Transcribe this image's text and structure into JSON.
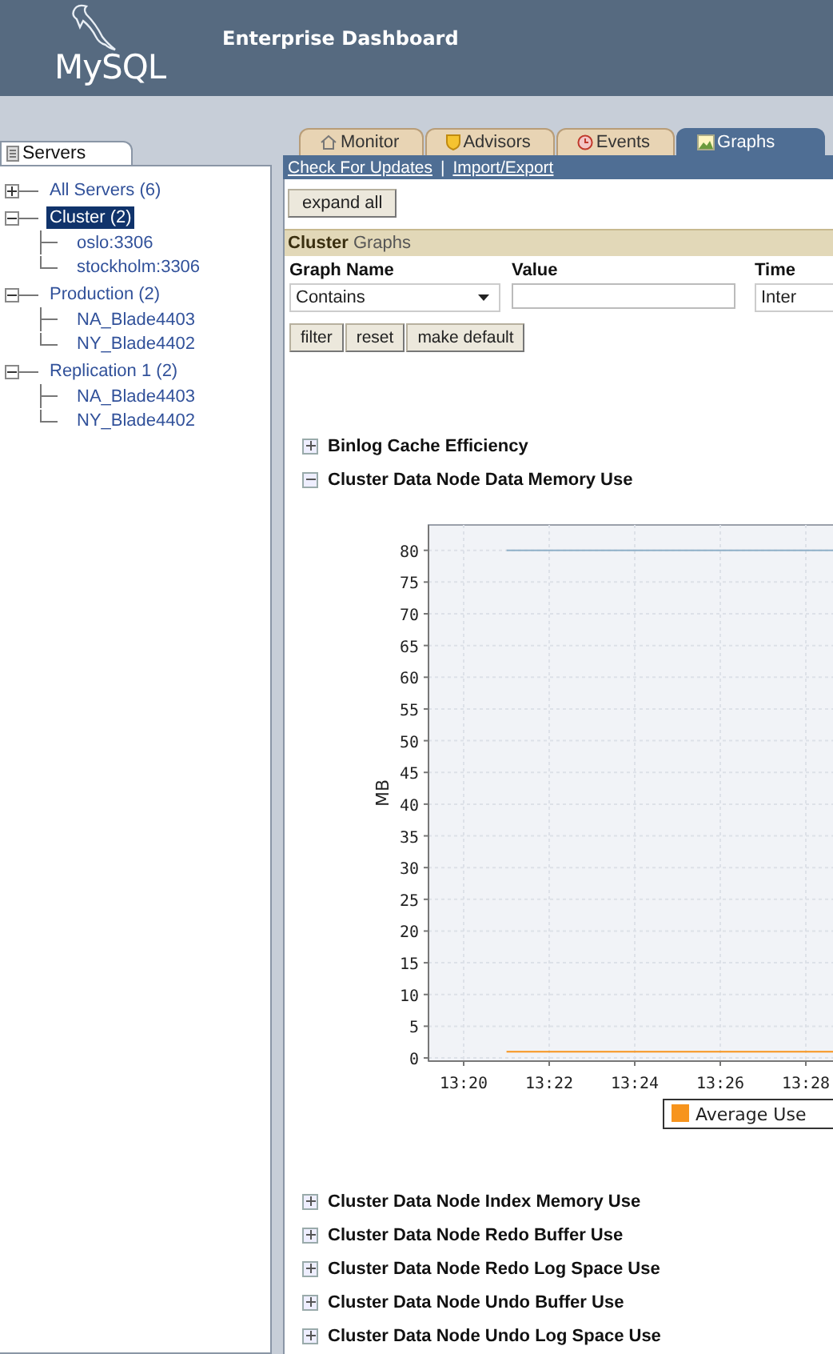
{
  "header": {
    "logo": "MySQL",
    "title": "Enterprise Dashboard"
  },
  "sidebar": {
    "tab": "Servers",
    "tree": [
      {
        "label": "All Servers (6)",
        "expanded": false,
        "selected": false
      },
      {
        "label": "Cluster (2)",
        "expanded": true,
        "selected": true,
        "children": [
          {
            "label": "oslo:3306",
            "selected": false
          },
          {
            "label": "stockholm:3306",
            "selected": false
          }
        ]
      },
      {
        "label": "Production (2)",
        "expanded": true,
        "selected": false,
        "children": [
          {
            "label": "NA_Blade4403",
            "selected": false
          },
          {
            "label": "NY_Blade4402",
            "selected": false
          }
        ]
      },
      {
        "label": "Replication 1 (2)",
        "expanded": true,
        "selected": false,
        "children": [
          {
            "label": "NA_Blade4403",
            "selected": false
          },
          {
            "label": "NY_Blade4402",
            "selected": false
          }
        ]
      }
    ]
  },
  "tabs": [
    {
      "label": "Monitor",
      "selected": false
    },
    {
      "label": "Advisors",
      "selected": false
    },
    {
      "label": "Events",
      "selected": false
    },
    {
      "label": "Graphs",
      "selected": true
    }
  ],
  "links": [
    "Check For Updates",
    "Import/Export"
  ],
  "link_separator": "|",
  "expand_button": "expand all",
  "section_title": "**Cluster** Graphs",
  "filter": {
    "columns": [
      {
        "heading": "Graph Name",
        "kind": "select",
        "value": "Contains"
      },
      {
        "heading": "Value",
        "kind": "input"
      },
      {
        "heading": "Time",
        "kind": "select",
        "value": "Inter"
      }
    ],
    "buttons": [
      "filter",
      "reset",
      "make default"
    ]
  },
  "graphs": [
    {
      "title": "Binlog Cache Efficiency",
      "expanded": false
    },
    {
      "title": "Cluster Data Node Data Memory Use",
      "expanded": true,
      "chart_data": {
        "type": "line",
        "ylabel": "MB",
        "categories": [
          "13:20",
          null,
          "13:22",
          null,
          "13:24",
          null,
          "13:26",
          null,
          "13:28",
          null
        ],
        "ylim": [
          -0.5,
          84
        ],
        "grid": true,
        "yticks": [
          0,
          5,
          10,
          15,
          20,
          25,
          30,
          35,
          40,
          45,
          50,
          55,
          60,
          65,
          70,
          75,
          80
        ],
        "series": [
          {
            "name": "Average Use",
            "color": "#f7941d",
            "values": [
              null,
              1,
              1,
              1,
              1,
              1,
              1,
              1,
              1,
              1
            ]
          },
          {
            "color": "#8fb0c8",
            "values": [
              null,
              80,
              80,
              80,
              80,
              80,
              80,
              80,
              80,
              80
            ]
          }
        ]
      }
    },
    {
      "title": "Cluster Data Node Index Memory Use",
      "expanded": false
    },
    {
      "title": "Cluster Data Node Redo Buffer Use",
      "expanded": false
    },
    {
      "title": "Cluster Data Node Redo Log Space Use",
      "expanded": false
    },
    {
      "title": "Cluster Data Node Undo Buffer Use",
      "expanded": false
    },
    {
      "title": "Cluster Data Node Undo Log Space Use",
      "expanded": false
    }
  ]
}
